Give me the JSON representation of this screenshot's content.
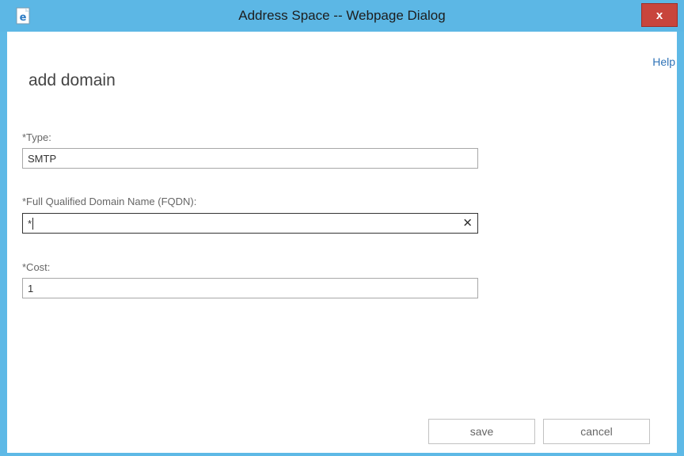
{
  "window": {
    "title": "Address Space -- Webpage Dialog",
    "close_label": "x",
    "accent": "#5cb7e5",
    "close_color": "#c8453c"
  },
  "header": {
    "help_label": "Help",
    "page_title": "add domain"
  },
  "form": {
    "type": {
      "label": "*Type:",
      "value": "SMTP"
    },
    "fqdn": {
      "label": "*Full Qualified Domain Name (FQDN):",
      "value": "*",
      "clear_icon": "✕"
    },
    "cost": {
      "label": "*Cost:",
      "value": "1"
    }
  },
  "footer": {
    "save_label": "save",
    "cancel_label": "cancel"
  },
  "icons": {
    "app_icon": "ie-document-icon",
    "clear_icon": "clear-icon"
  }
}
